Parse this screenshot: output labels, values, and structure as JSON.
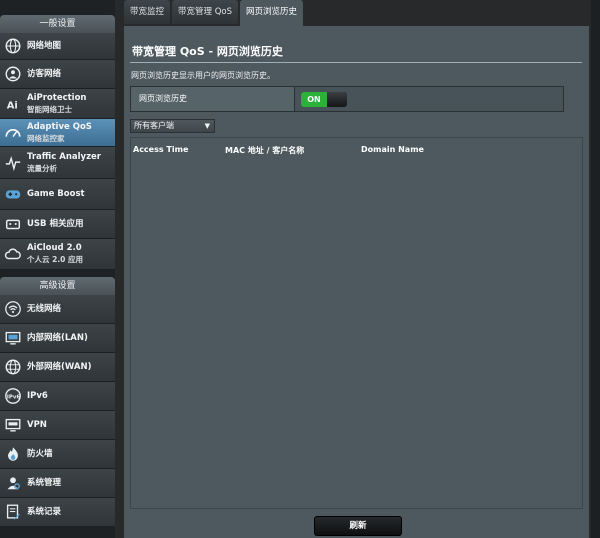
{
  "sidebar": {
    "general_header": "一般设置",
    "advanced_header": "高级设置",
    "general_items": [
      {
        "title": "网络地图",
        "subtitle": "",
        "icon": "globe-icon"
      },
      {
        "title": "访客网络",
        "subtitle": "",
        "icon": "guest-globe-icon"
      },
      {
        "title": "AiProtection",
        "subtitle": "智能网络卫士",
        "icon": "ai-protection-icon"
      },
      {
        "title": "Adaptive QoS",
        "subtitle": "网络监控家",
        "icon": "gauge-icon"
      },
      {
        "title": "Traffic Analyzer",
        "subtitle": "流量分析",
        "icon": "pulse-icon"
      },
      {
        "title": "Game Boost",
        "subtitle": "",
        "icon": "gamepad-icon"
      },
      {
        "title": "USB 相关应用",
        "subtitle": "",
        "icon": "usb-icon"
      },
      {
        "title": "AiCloud 2.0",
        "subtitle": "个人云 2.0 应用",
        "icon": "cloud-icon"
      }
    ],
    "advanced_items": [
      {
        "title": "无线网络",
        "icon": "wifi-icon"
      },
      {
        "title": "内部网络(LAN)",
        "icon": "lan-icon"
      },
      {
        "title": "外部网络(WAN)",
        "icon": "wan-globe-icon"
      },
      {
        "title": "IPv6",
        "icon": "ipv6-icon"
      },
      {
        "title": "VPN",
        "icon": "vpn-icon"
      },
      {
        "title": "防火墙",
        "icon": "firewall-icon"
      },
      {
        "title": "系统管理",
        "icon": "admin-gear-icon"
      },
      {
        "title": "系统记录",
        "icon": "log-icon"
      }
    ]
  },
  "tabs": [
    "带宽监控",
    "带宽管理 QoS",
    "网页浏览历史"
  ],
  "main": {
    "title": "带宽管理 QoS - 网页浏览历史",
    "description": "网页浏览历史显示用户的网页浏览历史。",
    "toggle_label": "网页浏览历史",
    "toggle_state": "ON",
    "client_select": "所有客户端",
    "table_headers": [
      "Access Time",
      "MAC 地址 / 客户名称",
      "Domain Name"
    ],
    "refresh_label": "刷新"
  },
  "colors": {
    "active_item": "#4a82a8",
    "toggle_on": "#2bb238",
    "panel": "#4d595f"
  }
}
